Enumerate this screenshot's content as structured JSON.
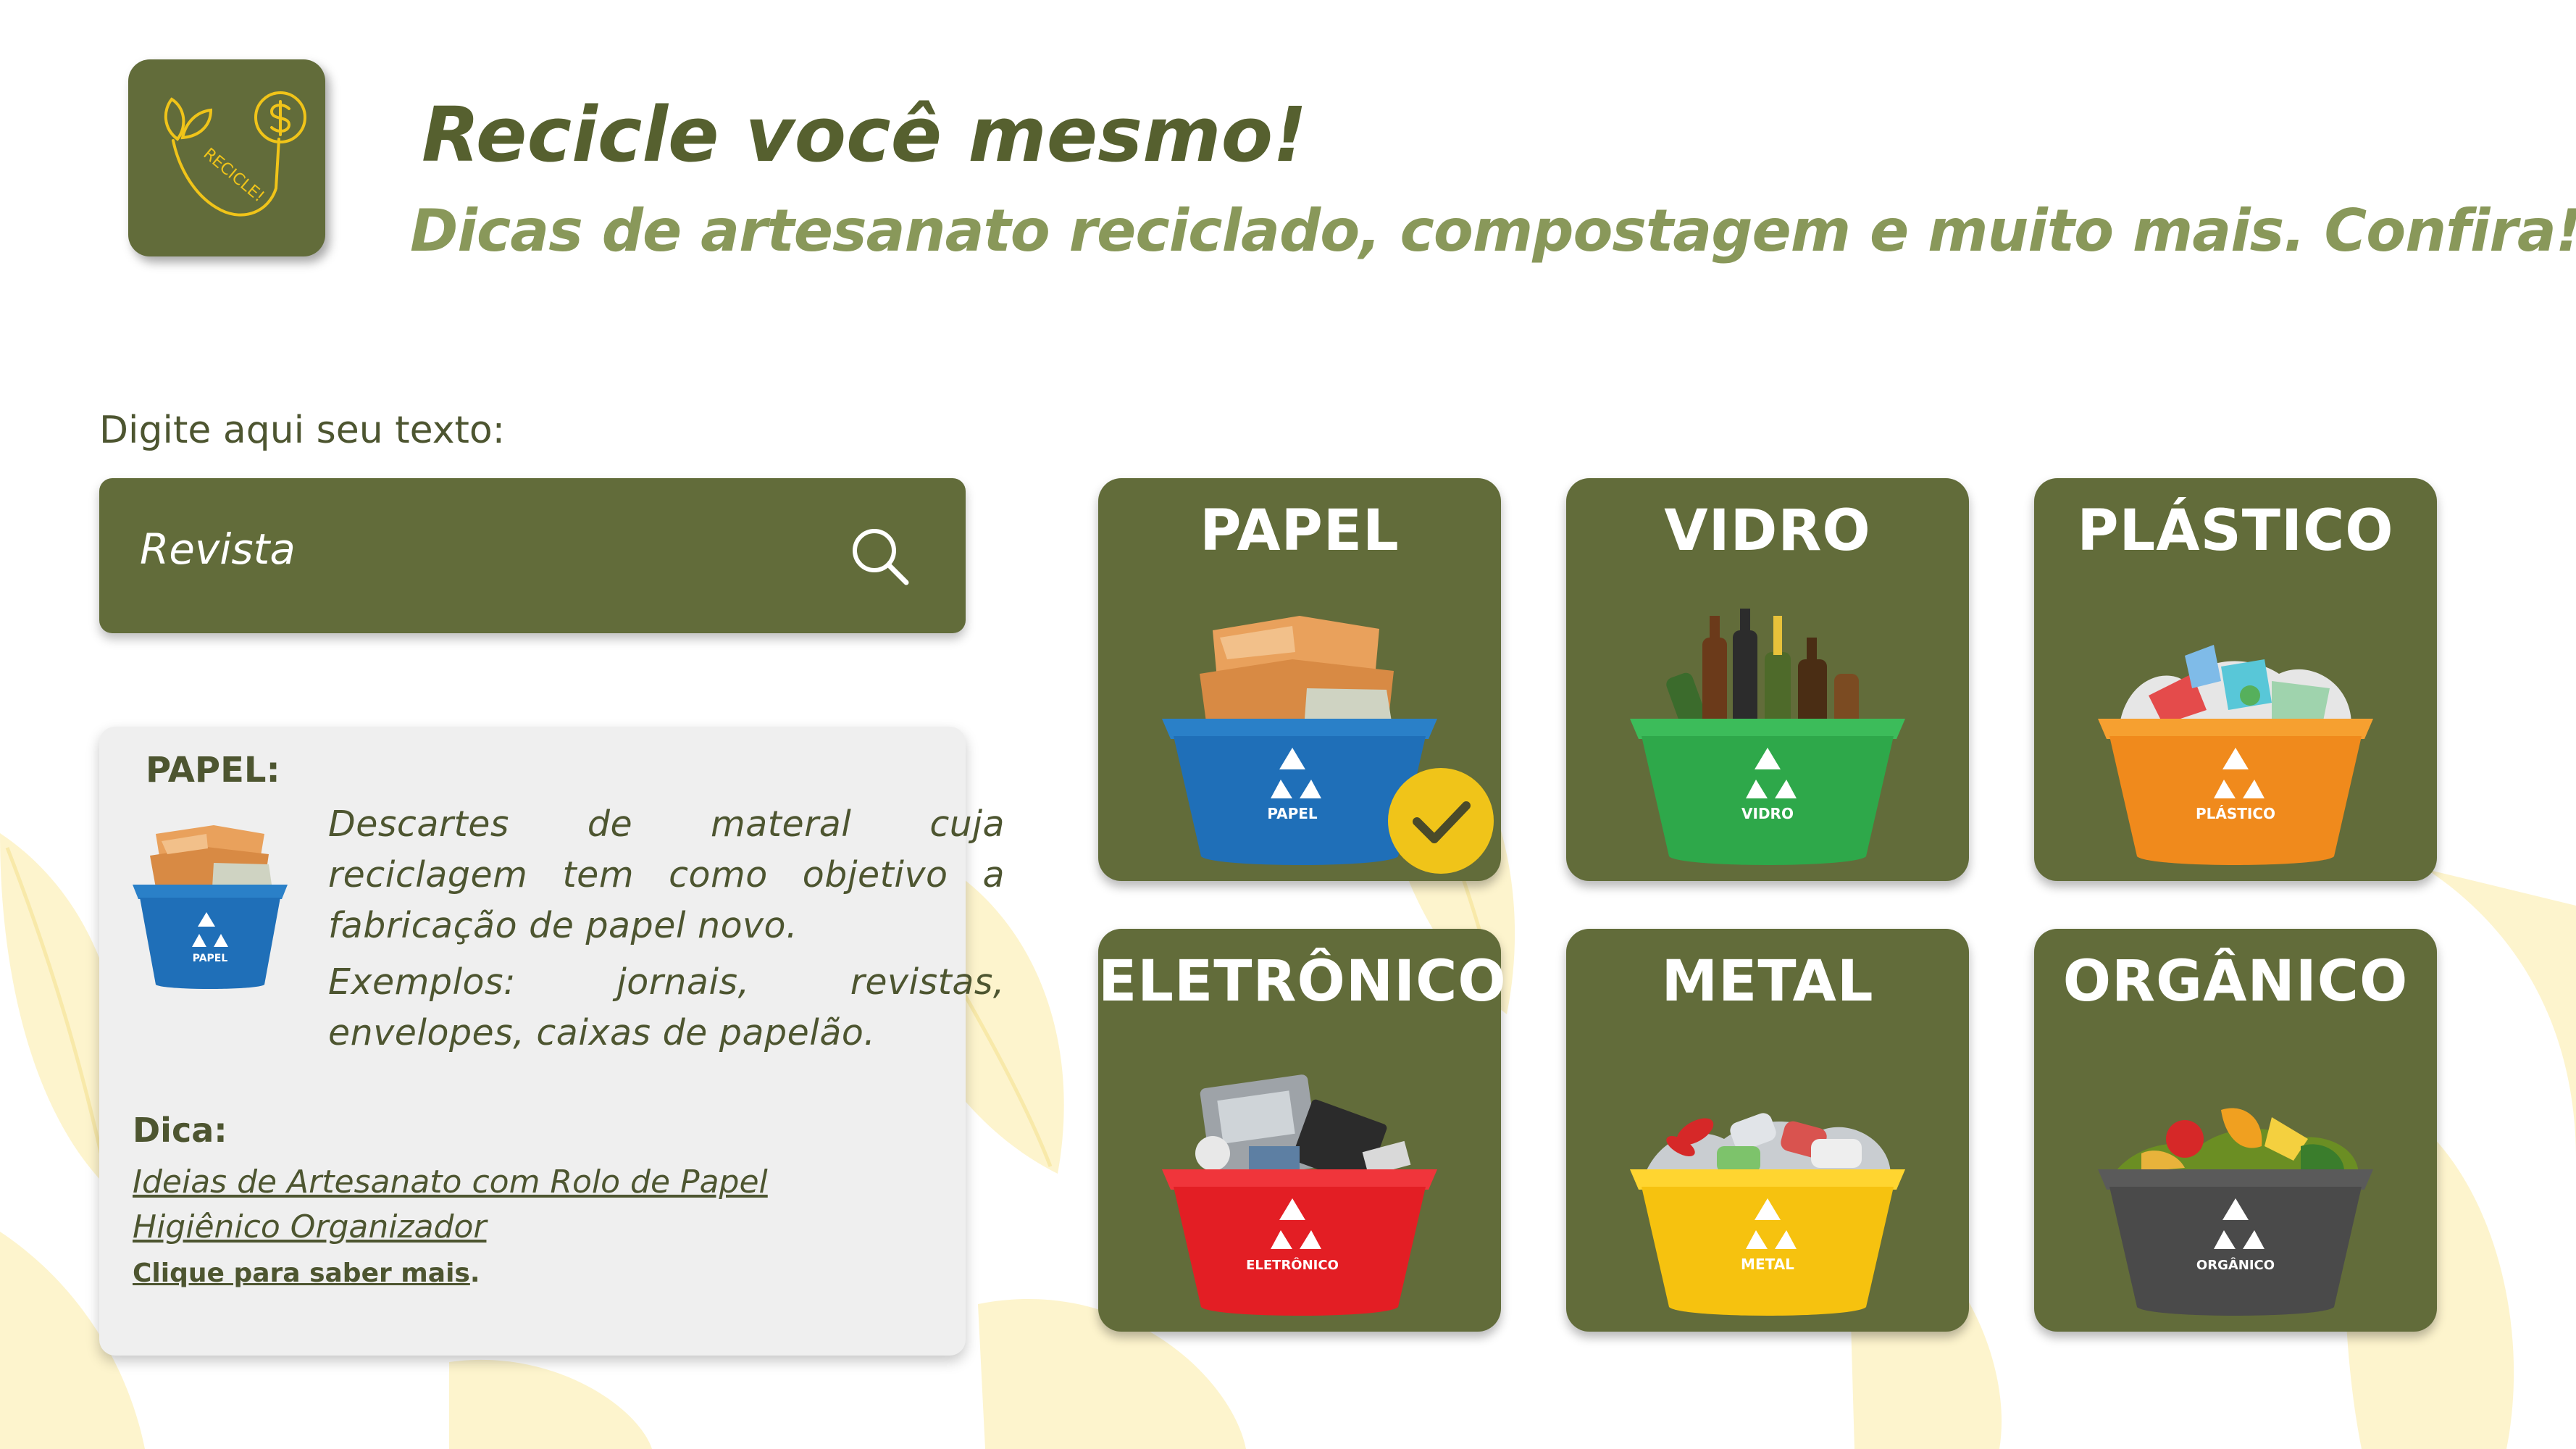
{
  "header": {
    "logo_text": "RECICLE!",
    "title": "Recicle você mesmo!",
    "subtitle": "Dicas de artesanato reciclado, compostagem e muito mais. Confira!"
  },
  "search": {
    "label": "Digite aqui seu texto:",
    "value": "Revista",
    "icon": "search-icon"
  },
  "info": {
    "heading": "PAPEL:",
    "description": "Descartes de materal cuja reciclagem tem como objetivo a fabricação de papel novo.",
    "examples": "Exemplos: jornais, revistas, envelopes, caixas de papelão.",
    "tip_label": "Dica:",
    "tip_link": "Ideias de Artesanato com Rolo de Papel Higiênico Organizador",
    "more_link": "Clique para saber mais",
    "more_suffix": ".",
    "bin_label": "PAPEL"
  },
  "categories": [
    {
      "name": "PAPEL",
      "bin_label": "PAPEL",
      "bin_color": "#1f6fb8",
      "selected": true
    },
    {
      "name": "VIDRO",
      "bin_label": "VIDRO",
      "bin_color": "#2ea84a",
      "selected": false
    },
    {
      "name": "PLÁSTICO",
      "bin_label": "PLÁSTICO",
      "bin_color": "#f08a1c",
      "selected": false
    },
    {
      "name": "ELETRÔNICO",
      "bin_label": "ELETRÔNICO",
      "bin_color": "#e31e24",
      "selected": false
    },
    {
      "name": "METAL",
      "bin_label": "METAL",
      "bin_color": "#f6c20f",
      "selected": false
    },
    {
      "name": "ORGÂNICO",
      "bin_label": "ORGÂNICO",
      "bin_color": "#4a4a4a",
      "selected": false
    }
  ],
  "colors": {
    "primary": "#626c3a",
    "title": "#56602f",
    "subtitle": "#89985a",
    "check_badge": "#f0c419",
    "leaf_bg": "#fdf3c4"
  }
}
